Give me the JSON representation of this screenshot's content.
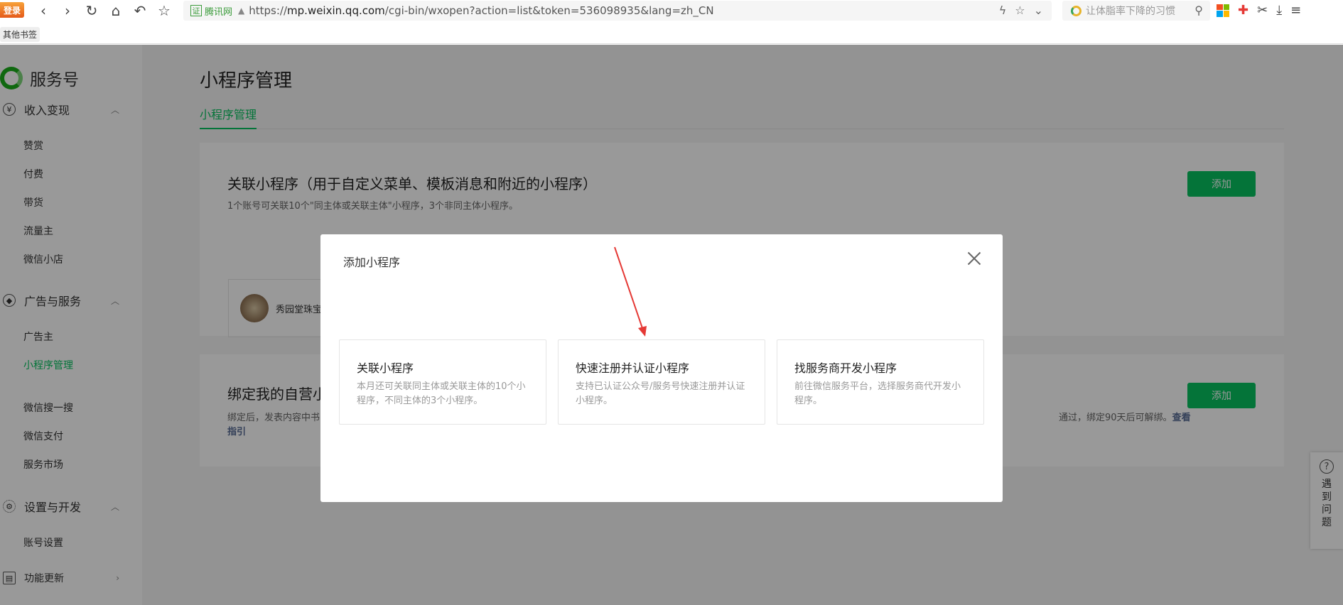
{
  "browser": {
    "login_badge": "登录",
    "secure_label": "腾讯网",
    "url_prefix": "https://",
    "url_domain": "mp.weixin.qq.com",
    "url_path": "/cgi-bin/wxopen?action=list&token=536098935&lang=zh_CN",
    "search_placeholder": "让体脂率下降的习惯",
    "bookmark": "其他书签"
  },
  "sidebar": {
    "brand": "服务号",
    "groups": [
      {
        "label": "收入变现",
        "icon": "coin-icon"
      },
      {
        "label": "广告与服务",
        "icon": "compass-icon"
      },
      {
        "label": "设置与开发",
        "icon": "gear-icon"
      },
      {
        "label": "功能更新",
        "icon": "doc-icon"
      }
    ],
    "items": {
      "zanshang": "赞赏",
      "fufei": "付费",
      "daihuo": "带货",
      "liuliangzhu": "流量主",
      "weixinxiaodian": "微信小店",
      "guanggaozhu": "广告主",
      "xiaochengxu": "小程序管理",
      "sousuo": "微信搜一搜",
      "zhifu": "微信支付",
      "shichang": "服务市场",
      "zhanghao": "账号设置"
    }
  },
  "main": {
    "title": "小程序管理",
    "tab": "小程序管理",
    "card1": {
      "title": "关联小程序（用于自定义菜单、模板消息和附近的小程序）",
      "desc": "1个账号可关联10个\"同主体或关联主体\"小程序，3个非同主体小程序。",
      "add": "添加",
      "item_name": "秀园堂珠宝"
    },
    "card2": {
      "title": "绑定我的自营小程序",
      "desc_start": "绑定后，发表内容中书",
      "desc_end": "通过，绑定90天后可解绑。",
      "link": "查看指引",
      "add": "添加"
    }
  },
  "help": {
    "text": "遇到问题"
  },
  "dialog": {
    "title": "添加小程序",
    "options": [
      {
        "title": "关联小程序",
        "desc": "本月还可关联同主体或关联主体的10个小程序，不同主体的3个小程序。"
      },
      {
        "title": "快速注册并认证小程序",
        "desc": "支持已认证公众号/服务号快速注册并认证小程序。"
      },
      {
        "title": "找服务商开发小程序",
        "desc": "前往微信服务平台，选择服务商代开发小程序。"
      }
    ]
  },
  "colors": {
    "accent": "#07c160",
    "annotation_arrow": "#e53935"
  }
}
